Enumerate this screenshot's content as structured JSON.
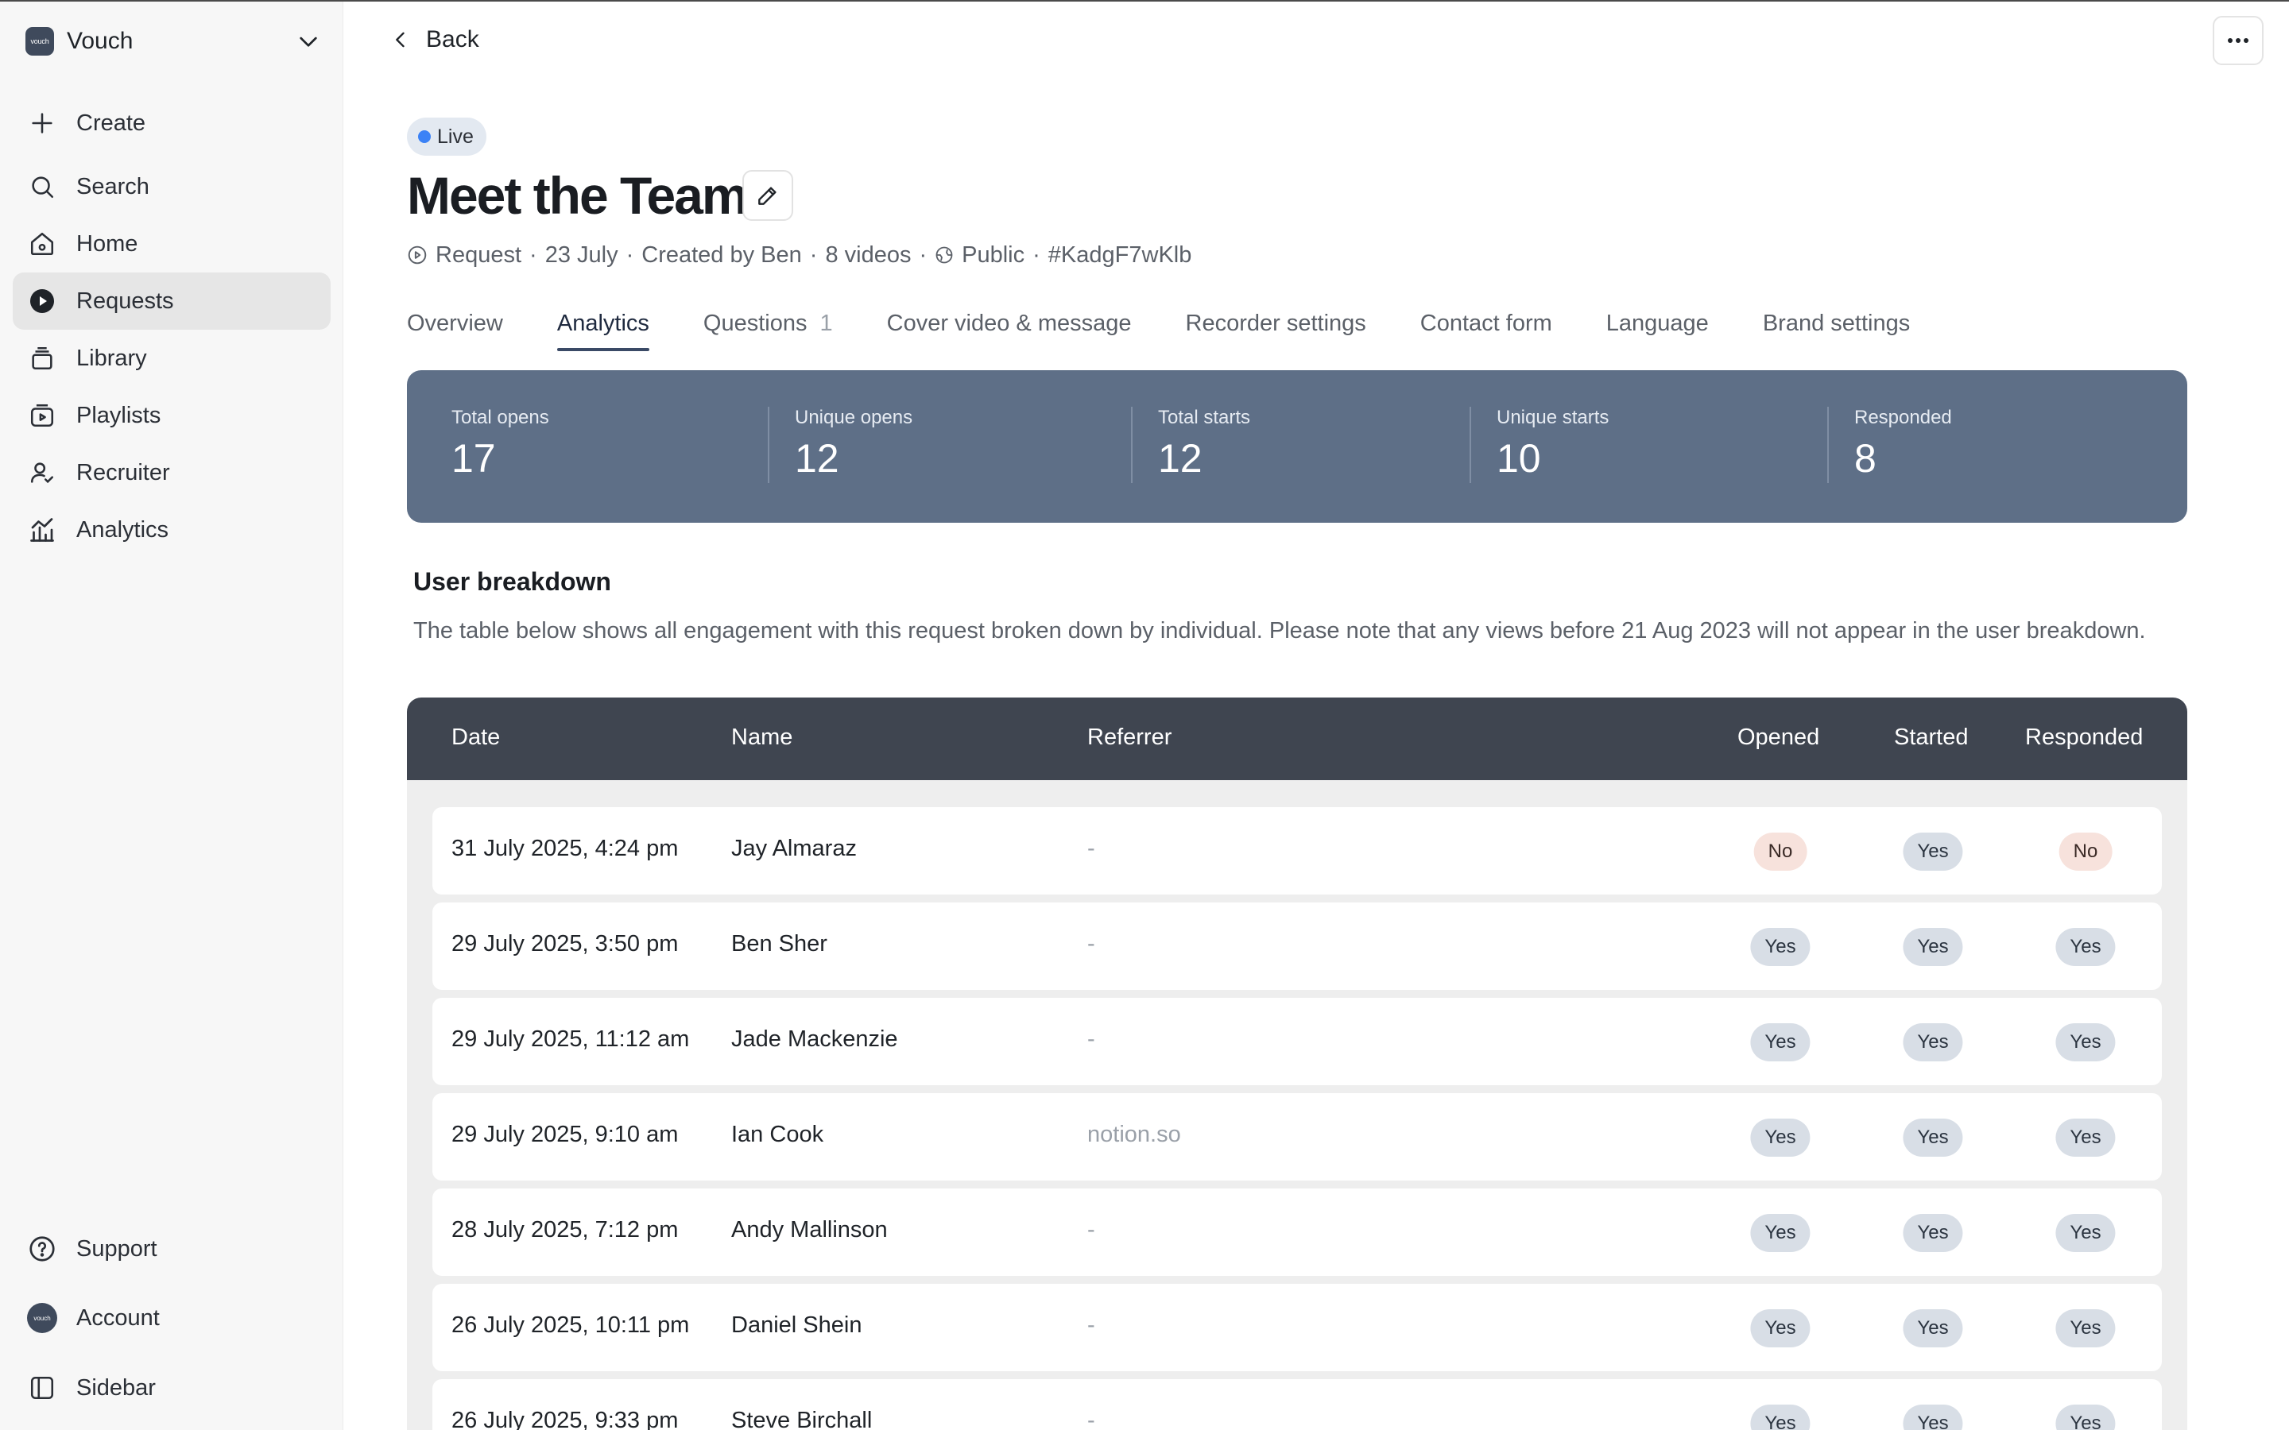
{
  "workspace": {
    "logo_text": "vouch",
    "name": "Vouch"
  },
  "nav": {
    "items": [
      {
        "label": "Create",
        "icon": "plus-icon"
      },
      {
        "label": "Search",
        "icon": "search-icon"
      },
      {
        "label": "Home",
        "icon": "home-icon"
      },
      {
        "label": "Requests",
        "icon": "requests-icon",
        "active": true
      },
      {
        "label": "Library",
        "icon": "library-icon"
      },
      {
        "label": "Playlists",
        "icon": "playlists-icon"
      },
      {
        "label": "Recruiter",
        "icon": "recruiter-icon"
      },
      {
        "label": "Analytics",
        "icon": "analytics-icon"
      }
    ],
    "bottom": [
      {
        "label": "Support",
        "icon": "help-icon"
      },
      {
        "label": "Account",
        "icon": "account-avatar-icon"
      },
      {
        "label": "Sidebar",
        "icon": "sidebar-toggle-icon"
      }
    ]
  },
  "header": {
    "back_label": "Back"
  },
  "request": {
    "status": "Live",
    "title": "Meet the Team",
    "meta": {
      "type": "Request",
      "date": "23 July",
      "created_by": "Created by Ben",
      "videos": "8 videos",
      "visibility": "Public",
      "id": "#KadgF7wKlb"
    }
  },
  "tabs": [
    {
      "label": "Overview"
    },
    {
      "label": "Analytics",
      "active": true
    },
    {
      "label": "Questions",
      "count": "1"
    },
    {
      "label": "Cover video & message"
    },
    {
      "label": "Recorder settings"
    },
    {
      "label": "Contact form"
    },
    {
      "label": "Language"
    },
    {
      "label": "Brand settings"
    }
  ],
  "stats": [
    {
      "label": "Total opens",
      "value": "17"
    },
    {
      "label": "Unique opens",
      "value": "12"
    },
    {
      "label": "Total starts",
      "value": "12"
    },
    {
      "label": "Unique starts",
      "value": "10"
    },
    {
      "label": "Responded",
      "value": "8"
    }
  ],
  "user_breakdown": {
    "title": "User breakdown",
    "description": "The table below shows all engagement with this request broken down by individual. Please note that any views before 21 Aug 2023 will not appear in the user breakdown.",
    "columns": {
      "date": "Date",
      "name": "Name",
      "referrer": "Referrer",
      "opened": "Opened",
      "started": "Started",
      "responded": "Responded"
    },
    "rows": [
      {
        "date": "31 July 2025, 4:24 pm",
        "name": "Jay Almaraz",
        "referrer": "-",
        "opened": "No",
        "started": "Yes",
        "responded": "No"
      },
      {
        "date": "29 July 2025, 3:50 pm",
        "name": "Ben Sher",
        "referrer": "-",
        "opened": "Yes",
        "started": "Yes",
        "responded": "Yes"
      },
      {
        "date": "29 July 2025, 11:12 am",
        "name": "Jade Mackenzie",
        "referrer": "-",
        "opened": "Yes",
        "started": "Yes",
        "responded": "Yes"
      },
      {
        "date": "29 July 2025, 9:10 am",
        "name": "Ian Cook",
        "referrer": "notion.so",
        "opened": "Yes",
        "started": "Yes",
        "responded": "Yes"
      },
      {
        "date": "28 July 2025, 7:12 pm",
        "name": "Andy Mallinson",
        "referrer": "-",
        "opened": "Yes",
        "started": "Yes",
        "responded": "Yes"
      },
      {
        "date": "26 July 2025, 10:11 pm",
        "name": "Daniel Shein",
        "referrer": "-",
        "opened": "Yes",
        "started": "Yes",
        "responded": "Yes"
      },
      {
        "date": "26 July 2025, 9:33 pm",
        "name": "Steve Birchall",
        "referrer": "-",
        "opened": "Yes",
        "started": "Yes",
        "responded": "Yes"
      }
    ]
  },
  "colors": {
    "stats_bg": "#5e6f87",
    "table_header_bg": "#3f4550",
    "live_dot": "#3b82f6",
    "pill_yes_bg": "#d8dee6",
    "pill_no_bg": "#f7e2dc"
  }
}
